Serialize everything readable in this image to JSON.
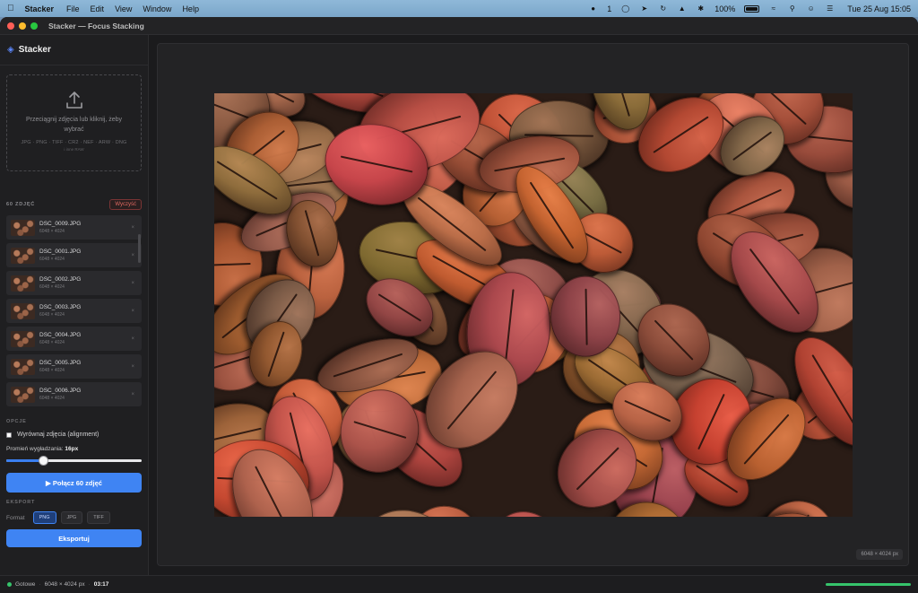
{
  "menubar": {
    "apple_icon": "apple-logo-icon",
    "app_name": "Stacker",
    "menus": [
      "File",
      "Edit",
      "View",
      "Window",
      "Help"
    ],
    "notifications_count": "1",
    "battery_percent": "100%",
    "clock": "Tue 25 Aug  15:05"
  },
  "window": {
    "title": "Stacker — Focus Stacking"
  },
  "sidebar": {
    "brand": "Stacker",
    "dropzone": {
      "text": "Przeciągnij zdjęcia lub kliknij, żeby wybrać",
      "formats": "JPG · PNG · TIFF · CR2 · NEF · ARW · DNG",
      "hint": "i inne RAW"
    },
    "files_count": "60 ZDJĘĆ",
    "clear_label": "Wyczyść",
    "files": [
      {
        "name": "DSC_0009.JPG",
        "size": "6048 × 4024"
      },
      {
        "name": "DSC_0001.JPG",
        "size": "6048 × 4024"
      },
      {
        "name": "DSC_0002.JPG",
        "size": "6048 × 4024"
      },
      {
        "name": "DSC_0003.JPG",
        "size": "6048 × 4024"
      },
      {
        "name": "DSC_0004.JPG",
        "size": "6048 × 4024"
      },
      {
        "name": "DSC_0005.JPG",
        "size": "6048 × 4024"
      },
      {
        "name": "DSC_0006.JPG",
        "size": "6048 × 4024"
      }
    ],
    "remove_glyph": "×",
    "options_label": "OPCJE",
    "align_label": "Wyrównaj zdjęcia (alignment)",
    "align_checked": false,
    "radius_prefix": "Promień wygładzania: ",
    "radius_value": "16px",
    "slider_fraction": 0.27,
    "combine_label": "▶ Połącz 60 zdjęć",
    "export_label": "EKSPORT",
    "format_label": "Format",
    "formats": [
      "PNG",
      "JPG",
      "TIFF"
    ],
    "selected_format": "PNG",
    "export_button": "Eksportuj"
  },
  "main": {
    "dimensions": "6048 × 4024 px"
  },
  "status": {
    "state": "Gotowe",
    "dimensions": "6048 × 4024 px",
    "separator": "·",
    "time": "03:17",
    "progress_fraction": 1.0
  },
  "colors": {
    "accent": "#3f84f3",
    "success": "#36c46b",
    "danger": "#e36a62"
  }
}
